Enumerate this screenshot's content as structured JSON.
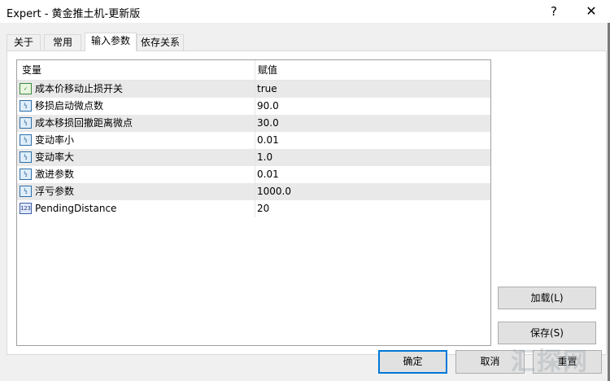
{
  "window": {
    "title": "Expert - 黄金推土机-更新版",
    "help_label": "?",
    "close_label": "✕"
  },
  "tabs": [
    {
      "label": "关于",
      "active": false
    },
    {
      "label": "常用",
      "active": false
    },
    {
      "label": "输入参数",
      "active": true
    },
    {
      "label": "依存关系",
      "active": false
    }
  ],
  "table": {
    "columns": {
      "variable": "变量",
      "value": "赋值"
    },
    "rows": [
      {
        "icon": "bool-icon",
        "name": "成本价移动止损开关",
        "value": "true"
      },
      {
        "icon": "double-icon",
        "name": "移损启动微点数",
        "value": "90.0"
      },
      {
        "icon": "double-icon",
        "name": "成本移损回撤距离微点",
        "value": "30.0"
      },
      {
        "icon": "double-icon",
        "name": "变动率小",
        "value": "0.01"
      },
      {
        "icon": "double-icon",
        "name": "变动率大",
        "value": "1.0"
      },
      {
        "icon": "double-icon",
        "name": "激进参数",
        "value": "0.01"
      },
      {
        "icon": "double-icon",
        "name": "浮亏参数",
        "value": "1000.0"
      },
      {
        "icon": "int-icon",
        "name": "PendingDistance",
        "value": "20"
      }
    ]
  },
  "buttons": {
    "load": "加载(L)",
    "save": "保存(S)",
    "ok": "确定",
    "cancel": "取消",
    "reset": "重置"
  },
  "watermark": "汇探网"
}
